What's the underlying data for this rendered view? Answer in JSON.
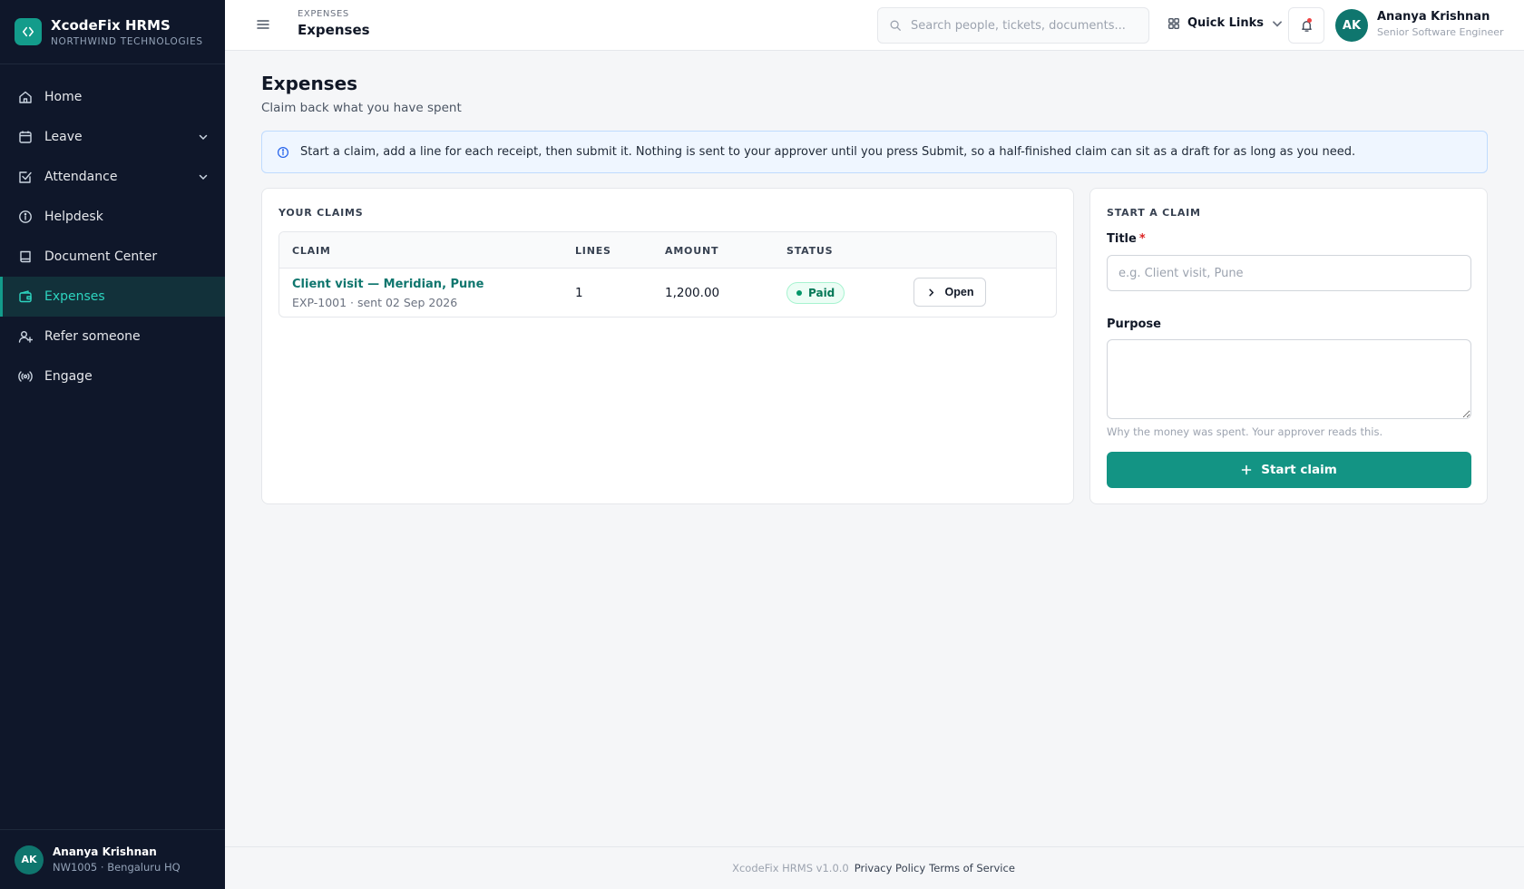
{
  "brand": {
    "name": "XcodeFix HRMS",
    "org": "NORTHWIND TECHNOLOGIES",
    "logo_icon": "code-brackets-icon",
    "accent": "#139c8b"
  },
  "sidebar": {
    "items": [
      {
        "label": "Home",
        "icon": "home-icon",
        "expandable": false,
        "active": false
      },
      {
        "label": "Leave",
        "icon": "calendar-icon",
        "expandable": true,
        "active": false
      },
      {
        "label": "Attendance",
        "icon": "calendar-check-icon",
        "expandable": true,
        "active": false
      },
      {
        "label": "Helpdesk",
        "icon": "info-circle-icon",
        "expandable": false,
        "active": false
      },
      {
        "label": "Document Center",
        "icon": "book-icon",
        "expandable": false,
        "active": false
      },
      {
        "label": "Expenses",
        "icon": "wallet-icon",
        "expandable": false,
        "active": true
      },
      {
        "label": "Refer someone",
        "icon": "user-plus-icon",
        "expandable": false,
        "active": false
      },
      {
        "label": "Engage",
        "icon": "broadcast-icon",
        "expandable": false,
        "active": false
      }
    ],
    "user": {
      "initials": "AK",
      "name": "Ananya Krishnan",
      "meta": "NW1005 · Bengaluru HQ"
    }
  },
  "header": {
    "breadcrumb_small": "EXPENSES",
    "breadcrumb_title": "Expenses",
    "search_placeholder": "Search people, tickets, documents...",
    "search_value": "",
    "quick_links_label": "Quick Links",
    "notifications_unread": true,
    "user": {
      "initials": "AK",
      "name": "Ananya Krishnan",
      "role": "Senior Software Engineer"
    }
  },
  "page": {
    "title": "Expenses",
    "subtitle": "Claim back what you have spent",
    "info_text": "Start a claim, add a line for each receipt, then submit it. Nothing is sent to your approver until you press Submit, so a half-finished claim can sit as a draft for as long as you need."
  },
  "claims": {
    "heading": "YOUR CLAIMS",
    "columns": {
      "claim": "CLAIM",
      "lines": "LINES",
      "amount": "AMOUNT",
      "status": "STATUS"
    },
    "rows": [
      {
        "title": "Client visit — Meridian, Pune",
        "meta": "EXP-1001 · sent 02 Sep 2026",
        "lines": "1",
        "amount": "1,200.00",
        "status": "Paid",
        "action_label": "Open"
      }
    ]
  },
  "start_claim": {
    "heading": "START A CLAIM",
    "title_label": "Title",
    "title_required_mark": "*",
    "title_placeholder": "e.g. Client visit, Pune",
    "title_value": "",
    "purpose_label": "Purpose",
    "purpose_value": "",
    "purpose_help": "Why the money was spent. Your approver reads this.",
    "button_label": "Start claim",
    "button_color": "#139484"
  },
  "footer": {
    "version": "XcodeFix HRMS v1.0.0",
    "privacy_label": "Privacy Policy",
    "terms_label": "Terms of Service"
  }
}
